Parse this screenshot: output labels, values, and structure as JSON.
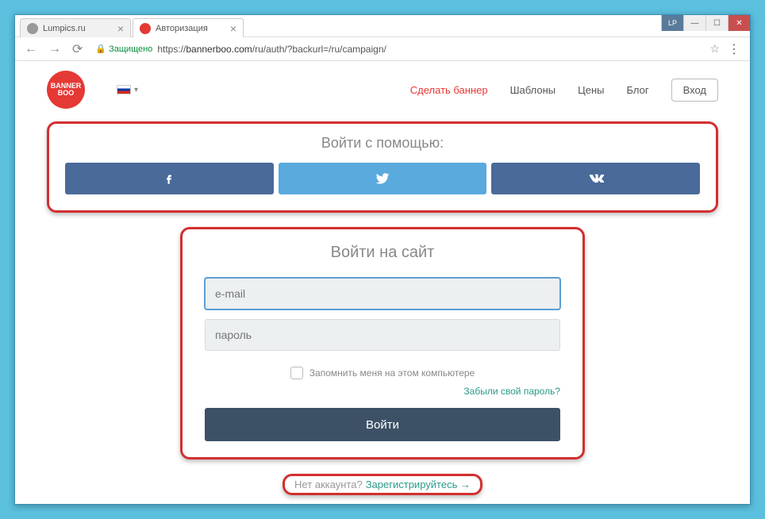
{
  "browser": {
    "tabs": [
      {
        "title": "Lumpics.ru",
        "active": false
      },
      {
        "title": "Авторизация",
        "active": true
      }
    ],
    "secure_label": "Защищено",
    "url_prefix": "https://",
    "url_domain": "bannerboo.com",
    "url_path": "/ru/auth/?backurl=/ru/campaign/",
    "user_badge": "LP"
  },
  "nav": {
    "make_banner": "Сделать баннер",
    "templates": "Шаблоны",
    "pricing": "Цены",
    "blog": "Блог",
    "login": "Вход"
  },
  "logo_text": "BANNER BOO",
  "social": {
    "title": "Войти с помощью:",
    "fb_name": "facebook",
    "tw_name": "twitter",
    "vk_name": "vk"
  },
  "login": {
    "title": "Войти на сайт",
    "email_placeholder": "e-mail",
    "password_placeholder": "пароль",
    "remember_label": "Запомнить меня на этом компьютере",
    "forgot": "Забыли свой пароль?",
    "submit": "Войти"
  },
  "register": {
    "question": "Нет аккаунта?",
    "link": "Зарегистрируйтесь →"
  }
}
